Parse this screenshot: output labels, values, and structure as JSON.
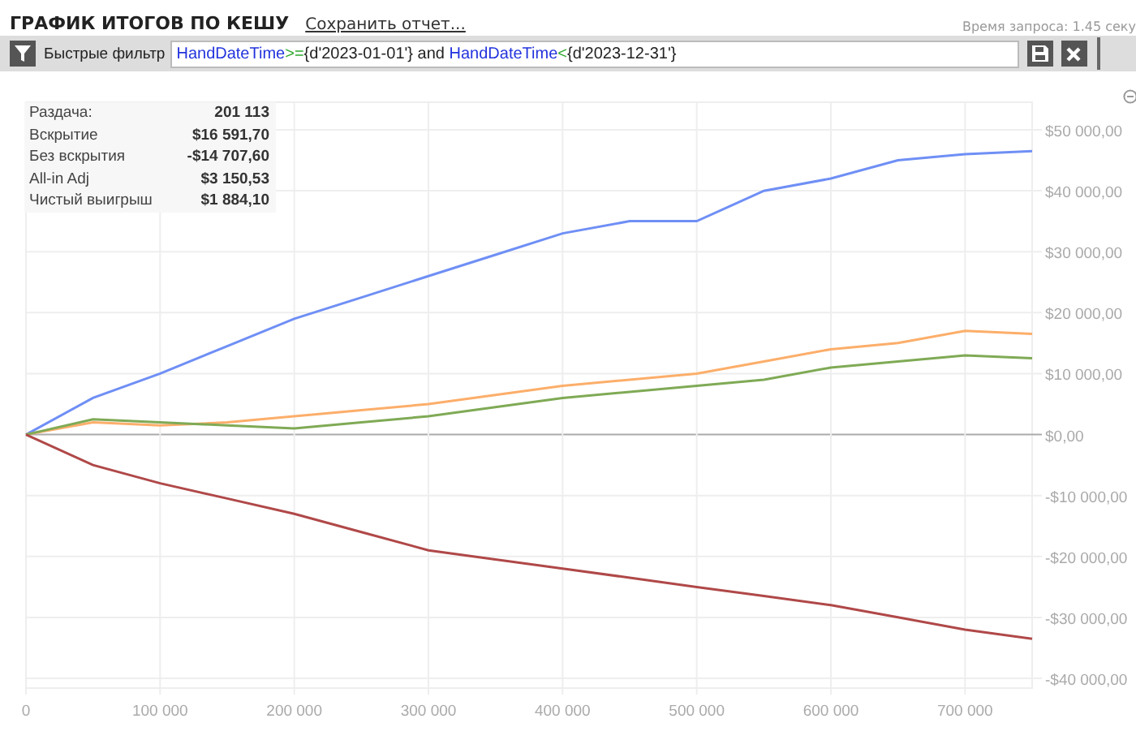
{
  "header": {
    "title": "ГРАФИК ИТОГОВ ПО КЕШУ",
    "save_link": "Сохранить отчет...",
    "query_time": "Время запроса: 1.45 секу"
  },
  "filter_bar": {
    "label": "Быстрые фильтр",
    "query": [
      {
        "kind": "field",
        "text": "HandDateTime"
      },
      {
        "kind": "op",
        "text": ">="
      },
      {
        "kind": "plain",
        "text": "{d'2023-01-01'} and "
      },
      {
        "kind": "field",
        "text": "HandDateTime"
      },
      {
        "kind": "op",
        "text": "<"
      },
      {
        "kind": "plain",
        "text": "{d'2023-12-31'}"
      }
    ]
  },
  "stats": [
    {
      "label": "Раздача:",
      "value": "201 113"
    },
    {
      "label": "Вскрытие",
      "value": "$16 591,70"
    },
    {
      "label": "Без вскрытия",
      "value": "-$14 707,60"
    },
    {
      "label": "All-in Adj",
      "value": "$3 150,53"
    },
    {
      "label": "Чистый выигрыш",
      "value": "$1 884,10"
    }
  ],
  "chart_data": {
    "type": "line",
    "x": [
      0,
      50000,
      100000,
      150000,
      200000,
      250000,
      300000,
      350000,
      400000,
      450000,
      500000,
      550000,
      600000,
      650000,
      700000,
      750000
    ],
    "series": [
      {
        "color": "#6f8ff5",
        "values": [
          0,
          6000,
          10000,
          14500,
          19000,
          22500,
          26000,
          29500,
          33000,
          35000,
          35000,
          40000,
          42000,
          45000,
          46000,
          46500
        ]
      },
      {
        "color": "#fcae6a",
        "values": [
          0,
          2000,
          1500,
          2000,
          3000,
          4000,
          5000,
          6500,
          8000,
          9000,
          10000,
          12000,
          14000,
          15000,
          17000,
          16500
        ]
      },
      {
        "color": "#7faa55",
        "values": [
          0,
          2500,
          2000,
          1500,
          1000,
          2000,
          3000,
          4500,
          6000,
          7000,
          8000,
          9000,
          11000,
          12000,
          13000,
          12500
        ]
      },
      {
        "color": "#b04848",
        "values": [
          0,
          -5000,
          -8000,
          -10500,
          -13000,
          -16000,
          -19000,
          -20500,
          -22000,
          -23500,
          -25000,
          -26500,
          -28000,
          -30000,
          -32000,
          -33500
        ]
      }
    ],
    "grid": true,
    "xlim": [
      0,
      750000
    ],
    "ylim": [
      -40000,
      50000
    ],
    "xticks": [
      {
        "value": 0,
        "label": "0"
      },
      {
        "value": 100000,
        "label": "100 000"
      },
      {
        "value": 200000,
        "label": "200 000"
      },
      {
        "value": 300000,
        "label": "300 000"
      },
      {
        "value": 400000,
        "label": "400 000"
      },
      {
        "value": 500000,
        "label": "500 000"
      },
      {
        "value": 600000,
        "label": "600 000"
      },
      {
        "value": 700000,
        "label": "700 000"
      }
    ],
    "yticks": [
      {
        "value": 50000,
        "label": "$50 000,00"
      },
      {
        "value": 40000,
        "label": "$40 000,00"
      },
      {
        "value": 30000,
        "label": "$30 000,00"
      },
      {
        "value": 20000,
        "label": "$20 000,00"
      },
      {
        "value": 10000,
        "label": "$10 000,00"
      },
      {
        "value": 0,
        "label": "$0,00"
      },
      {
        "value": -10000,
        "label": "-$10 000,00"
      },
      {
        "value": -20000,
        "label": "-$20 000,00"
      },
      {
        "value": -30000,
        "label": "-$30 000,00"
      },
      {
        "value": -40000,
        "label": "-$40 000,00"
      }
    ]
  }
}
